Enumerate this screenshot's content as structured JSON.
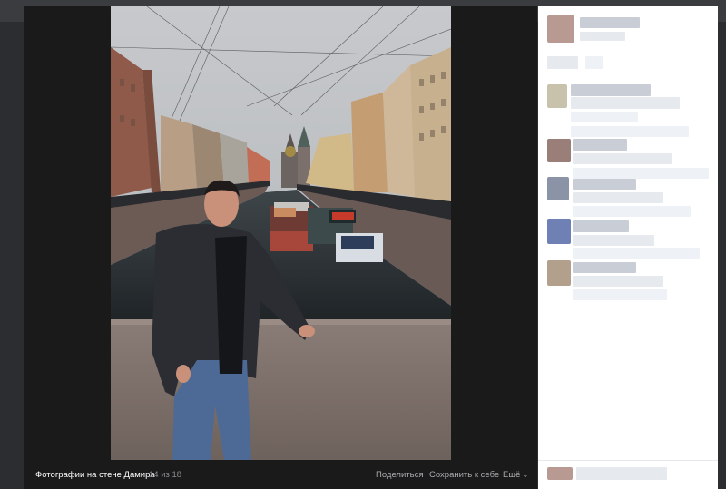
{
  "viewer": {
    "caption": "Фотографии на стене Дамира",
    "counter": "14 из 18",
    "actions": {
      "share": "Поделиться",
      "save": "Сохранить к себе",
      "more": "Ещё"
    },
    "more_chevron": "⌄"
  },
  "colors": {
    "page_bg": "#2b2d30",
    "viewer_bg": "#1a1a1a",
    "sidebar_bg": "#ffffff",
    "caption_text": "#ffffff",
    "muted_text": "#8a8c8f"
  },
  "sidebar": {
    "content": "pixelated / blurred comments"
  }
}
